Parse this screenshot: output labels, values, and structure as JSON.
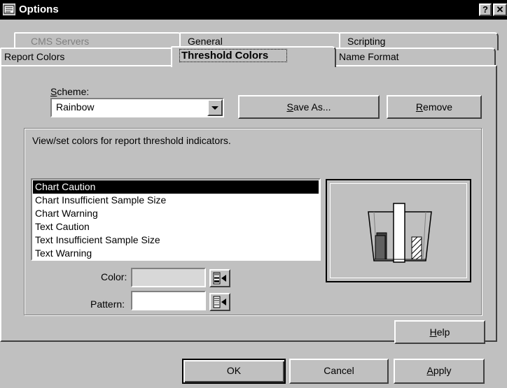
{
  "window": {
    "title": "Options",
    "help_glyph": "?",
    "close_glyph": "✕"
  },
  "tabs_back": [
    {
      "label": "CMS Servers"
    },
    {
      "label": "General"
    },
    {
      "label": "Scripting"
    }
  ],
  "tabs_front": [
    {
      "label": "Report Colors"
    },
    {
      "label": "Threshold Colors"
    },
    {
      "label": "Name Format"
    }
  ],
  "scheme": {
    "label_prefix": "",
    "label_mnemonic": "S",
    "label_rest": "cheme:",
    "value": "Rainbow"
  },
  "buttons": {
    "save_as": {
      "mnemonic": "S",
      "rest": "ave As..."
    },
    "remove": {
      "mnemonic": "R",
      "rest": "emove"
    },
    "help": {
      "mnemonic": "H",
      "rest": "elp"
    },
    "ok": {
      "label": "OK"
    },
    "cancel": {
      "label": "Cancel"
    },
    "apply": {
      "mnemonic": "A",
      "rest": "pply"
    }
  },
  "group": {
    "description": "View/set colors for report threshold indicators."
  },
  "indicators": [
    {
      "label": "Chart Caution",
      "selected": true
    },
    {
      "label": "Chart Insufficient Sample Size",
      "selected": false
    },
    {
      "label": "Chart Warning",
      "selected": false
    },
    {
      "label": "Text Caution",
      "selected": false
    },
    {
      "label": "Text Insufficient Sample Size",
      "selected": false
    },
    {
      "label": "Text Warning",
      "selected": false
    }
  ],
  "color_field": {
    "label": "Color:",
    "value": ""
  },
  "pattern_field": {
    "label": "Pattern:",
    "value": ""
  },
  "colors": {
    "selection": "#000000",
    "face": "#c0c0c0"
  },
  "icons": {
    "app": "options-dialog-icon",
    "dropdown": "chevron-down-icon",
    "picker": "color-picker-icon",
    "preview": "threshold-preview-icon"
  }
}
